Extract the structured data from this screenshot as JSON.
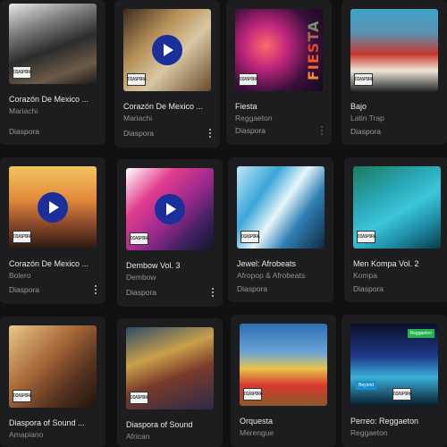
{
  "logo_text": "DIASPORA",
  "cards": [
    {
      "title": "Corazón De Mexico ...",
      "genre": "Mariachi",
      "label": "Diaspora"
    },
    {
      "title": "Corazón De Mexico ...",
      "genre": "Mariachi",
      "label": "Diaspora"
    },
    {
      "title": "Fiesta",
      "genre": "Reggaeton",
      "label": "Diaspora",
      "cover_text": "FIESTA"
    },
    {
      "title": "Bajo",
      "genre": "Latin Trap",
      "label": "Diaspora"
    },
    {
      "title": "Corazón De Mexico ...",
      "genre": "Bolero",
      "label": "Diaspora"
    },
    {
      "title": "Dembow Vol. 3",
      "genre": "Dembow",
      "label": "Diaspora"
    },
    {
      "title": "Jewel: Afrobeats",
      "genre": "Afropop & Afrobeats",
      "label": "Diaspora"
    },
    {
      "title": "Men Kompa Vol. 2",
      "genre": "Kompa",
      "label": "Diaspora"
    },
    {
      "title": "Diaspora of Sound ...",
      "genre": "Amapiano",
      "label": ""
    },
    {
      "title": "Diaspora of Sound",
      "genre": "African",
      "label": ""
    },
    {
      "title": "Orquesta",
      "genre": "Merengue",
      "label": ""
    },
    {
      "title": "Perreo: Reggaeton",
      "genre": "Reggaeton",
      "label": "",
      "badge_top": "Reggaeton",
      "badge_bottom": "Beyond"
    }
  ]
}
